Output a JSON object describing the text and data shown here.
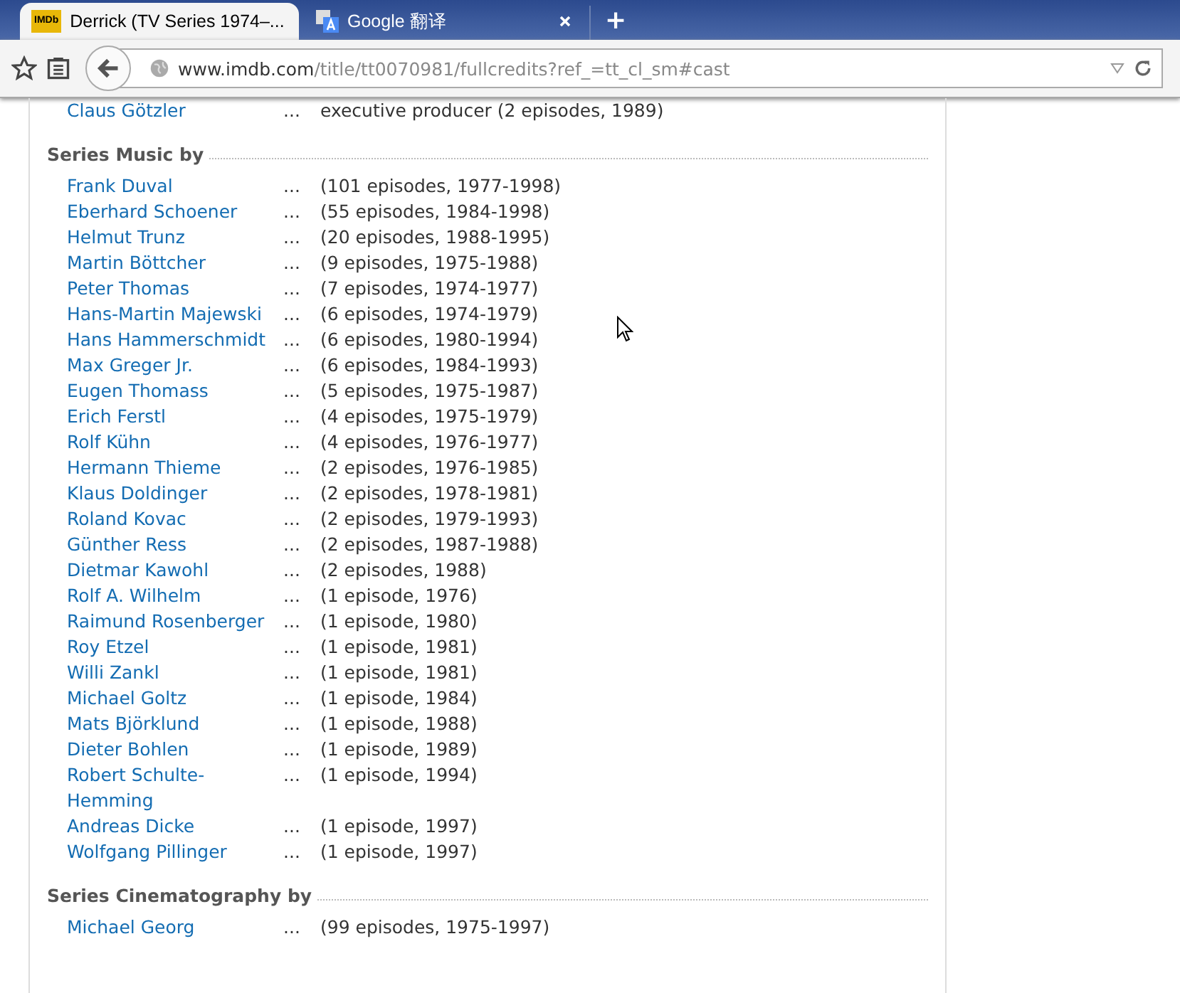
{
  "tabs": [
    {
      "title": "Derrick (TV Series 1974–...",
      "kind": "imdb",
      "favicon_text": "IMDb",
      "selected": true
    },
    {
      "title": "Google 翻译",
      "kind": "translate",
      "selected": false
    }
  ],
  "new_tab": "+",
  "address_bar": {
    "host": "www.imdb.com",
    "path": "/title/tt0070981/fullcredits?ref_=tt_cl_sm#cast"
  },
  "sections": [
    {
      "rows": [
        {
          "name": "Claus Götzler",
          "dots": "...",
          "credit": "executive producer (2 episodes, 1989)"
        }
      ]
    },
    {
      "title": "Series Music by",
      "rows": [
        {
          "name": "Frank Duval",
          "dots": "...",
          "credit": "(101 episodes, 1977-1998)"
        },
        {
          "name": "Eberhard Schoener",
          "dots": "...",
          "credit": "(55 episodes, 1984-1998)"
        },
        {
          "name": "Helmut Trunz",
          "dots": "...",
          "credit": "(20 episodes, 1988-1995)"
        },
        {
          "name": "Martin Böttcher",
          "dots": "...",
          "credit": "(9 episodes, 1975-1988)"
        },
        {
          "name": "Peter Thomas",
          "dots": "...",
          "credit": "(7 episodes, 1974-1977)"
        },
        {
          "name": "Hans-Martin Majewski",
          "dots": "...",
          "credit": "(6 episodes, 1974-1979)"
        },
        {
          "name": "Hans Hammerschmidt",
          "dots": "...",
          "credit": "(6 episodes, 1980-1994)"
        },
        {
          "name": "Max Greger Jr.",
          "dots": "...",
          "credit": "(6 episodes, 1984-1993)"
        },
        {
          "name": "Eugen Thomass",
          "dots": "...",
          "credit": "(5 episodes, 1975-1987)"
        },
        {
          "name": "Erich Ferstl",
          "dots": "...",
          "credit": "(4 episodes, 1975-1979)"
        },
        {
          "name": "Rolf Kühn",
          "dots": "...",
          "credit": "(4 episodes, 1976-1977)"
        },
        {
          "name": "Hermann Thieme",
          "dots": "...",
          "credit": "(2 episodes, 1976-1985)"
        },
        {
          "name": "Klaus Doldinger",
          "dots": "...",
          "credit": "(2 episodes, 1978-1981)"
        },
        {
          "name": "Roland Kovac",
          "dots": "...",
          "credit": "(2 episodes, 1979-1993)"
        },
        {
          "name": "Günther Ress",
          "dots": "...",
          "credit": "(2 episodes, 1987-1988)"
        },
        {
          "name": "Dietmar Kawohl",
          "dots": "...",
          "credit": "(2 episodes, 1988)"
        },
        {
          "name": "Rolf A. Wilhelm",
          "dots": "...",
          "credit": "(1 episode, 1976)"
        },
        {
          "name": "Raimund Rosenberger",
          "dots": "...",
          "credit": "(1 episode, 1980)"
        },
        {
          "name": "Roy Etzel",
          "dots": "...",
          "credit": "(1 episode, 1981)"
        },
        {
          "name": "Willi Zankl",
          "dots": "...",
          "credit": "(1 episode, 1981)"
        },
        {
          "name": "Michael Goltz",
          "dots": "...",
          "credit": "(1 episode, 1984)"
        },
        {
          "name": "Mats Björklund",
          "dots": "...",
          "credit": "(1 episode, 1988)"
        },
        {
          "name": "Dieter Bohlen",
          "dots": "...",
          "credit": "(1 episode, 1989)"
        },
        {
          "name": "Robert Schulte-Hemming",
          "dots": "...",
          "credit": "(1 episode, 1994)"
        },
        {
          "name": "Andreas Dicke",
          "dots": "...",
          "credit": "(1 episode, 1997)"
        },
        {
          "name": "Wolfgang Pillinger",
          "dots": "...",
          "credit": "(1 episode, 1997)"
        }
      ]
    },
    {
      "title": "Series Cinematography by",
      "rows": [
        {
          "name": "Michael Georg",
          "dots": "...",
          "credit": "(99 episodes, 1975-1997)"
        }
      ]
    }
  ]
}
